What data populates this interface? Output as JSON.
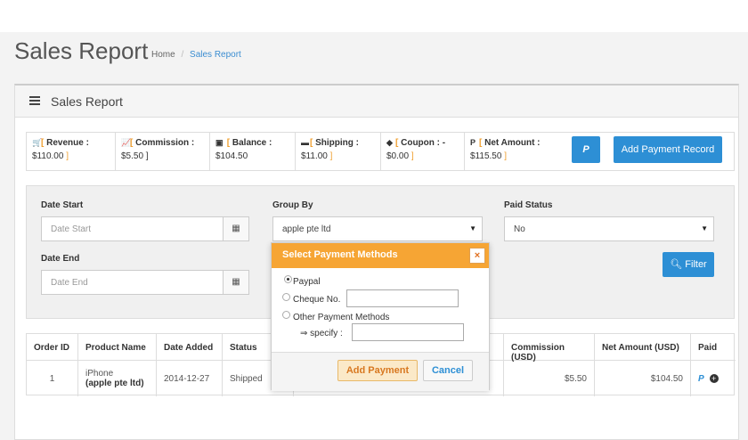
{
  "header": {
    "title": "Sales Report",
    "breadcrumb": {
      "home": "Home",
      "sep": "/",
      "current": "Sales Report"
    }
  },
  "panel": {
    "title": "Sales Report"
  },
  "summary": {
    "revenue": {
      "label": "Revenue :",
      "value": "$110.00"
    },
    "commission": {
      "label": "Commission :",
      "value": "$5.50"
    },
    "balance": {
      "label": "Balance :",
      "value": "$104.50"
    },
    "shipping": {
      "label": "Shipping :",
      "value": "$11.00"
    },
    "coupon": {
      "label": "Coupon : -",
      "value": "$0.00"
    },
    "net_amount": {
      "label": "Net Amount :",
      "value": "$115.50"
    },
    "paypal_button": "P",
    "add_payment_button": "Add Payment Record"
  },
  "filters": {
    "date_start": {
      "label": "Date Start",
      "placeholder": "Date Start"
    },
    "date_end": {
      "label": "Date End",
      "placeholder": "Date End"
    },
    "group_by": {
      "label": "Group By",
      "value": "apple pte ltd"
    },
    "paid_status": {
      "label": "Paid Status",
      "value": "No"
    },
    "filter_button": "Filter"
  },
  "table": {
    "headers": [
      "Order ID",
      "Product Name",
      "Date Added",
      "Status",
      "Commission (USD)",
      "Net Amount (USD)",
      "Paid"
    ],
    "row": {
      "order_id": "1",
      "product": "iPhone",
      "company": "(apple pte ltd)",
      "date_added": "2014-12-27",
      "status": "Shipped",
      "commission": "$5.50",
      "net_amount": "$104.50",
      "paid_icon": "P"
    }
  },
  "modal": {
    "title": "Select Payment Methods",
    "close": "×",
    "options": [
      "Paypal",
      "Cheque No.",
      "Other Payment Methods"
    ],
    "specify_label": "⇒ specify :",
    "add_button": "Add Payment",
    "cancel_button": "Cancel"
  },
  "colors": {
    "accent": "#2d8fd5",
    "modal_header": "#f6a534",
    "bracket": "#f0a030"
  }
}
